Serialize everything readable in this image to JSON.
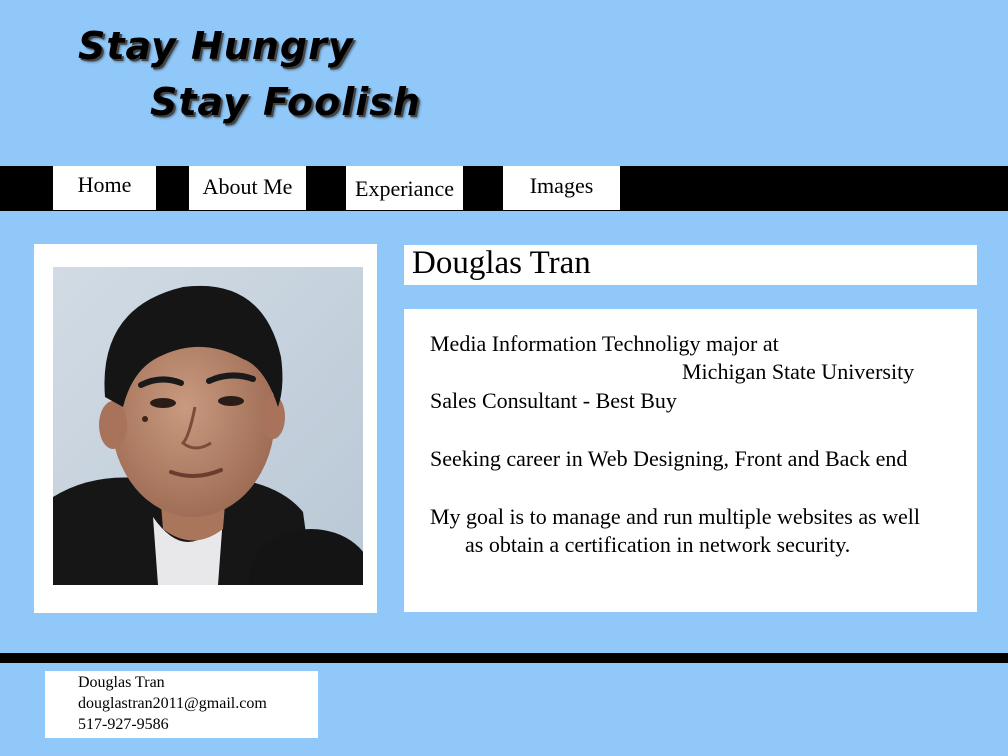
{
  "logo": {
    "line1": "Stay Hungry",
    "line2": "Stay Foolish"
  },
  "nav": {
    "items": [
      {
        "label": "Home"
      },
      {
        "label": "About Me"
      },
      {
        "label": "Experiance"
      },
      {
        "label": "Images"
      }
    ]
  },
  "profile": {
    "name": "Douglas Tran",
    "bio_lines": [
      "Media Information Technoligy major at",
      "Michigan State University",
      "Sales Consultant - Best Buy",
      "Seeking career in Web Designing, Front and Back end",
      "My goal is to manage and run multiple websites as well",
      "as obtain a certification in network security."
    ]
  },
  "footer": {
    "contact": {
      "name": "Douglas Tran",
      "email": "douglastran2011@gmail.com",
      "phone": "517-927-9586"
    }
  },
  "colors": {
    "background": "#8fc8f9",
    "bars": "#000000",
    "panels": "#ffffff"
  }
}
